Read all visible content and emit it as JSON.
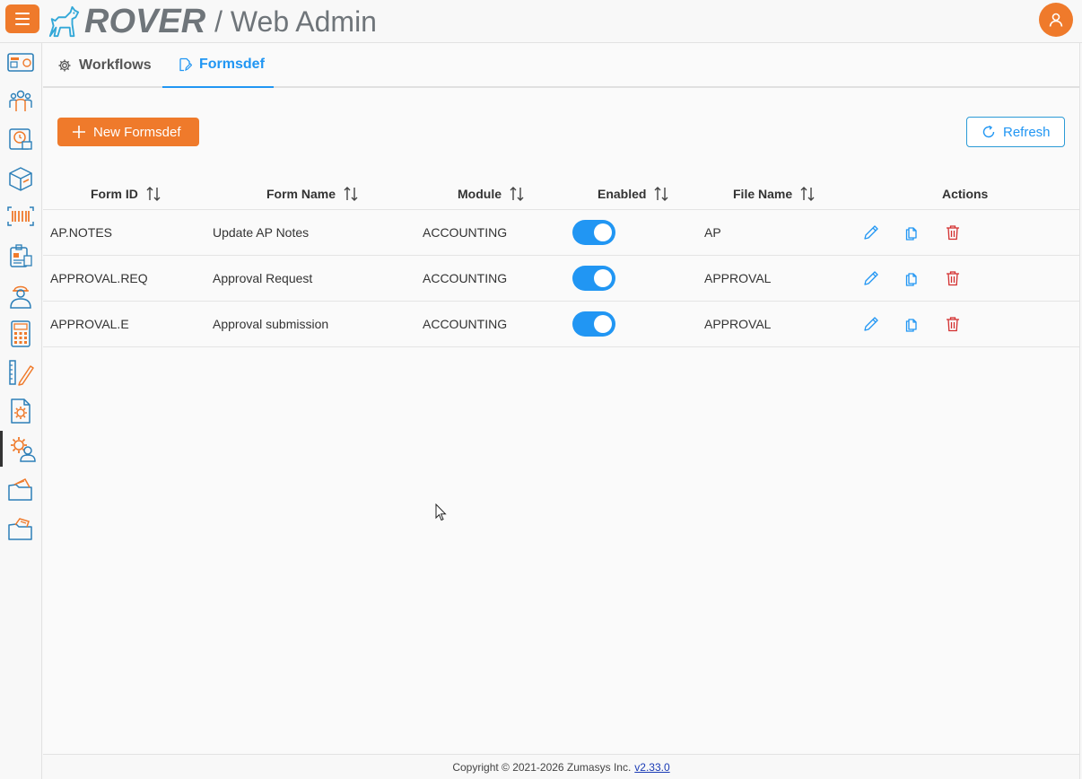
{
  "header": {
    "brand": "ROVER",
    "subtitle": "/ Web Admin",
    "menu_icon": "hamburger-icon",
    "avatar_icon": "user-icon"
  },
  "sidebar": {
    "items": [
      {
        "icon": "dashboard-icon"
      },
      {
        "icon": "users-group-icon"
      },
      {
        "icon": "clock-document-icon"
      },
      {
        "icon": "package-box-icon"
      },
      {
        "icon": "barcode-icon"
      },
      {
        "icon": "id-badge-icon"
      },
      {
        "icon": "worker-icon"
      },
      {
        "icon": "calculator-icon"
      },
      {
        "icon": "ruler-pencil-icon"
      },
      {
        "icon": "document-gear-icon"
      },
      {
        "icon": "user-gear-icon",
        "active": true
      },
      {
        "icon": "folder-open-icon"
      },
      {
        "icon": "folder-files-icon"
      }
    ]
  },
  "tabs": [
    {
      "label": "Workflows",
      "icon": "gear-icon"
    },
    {
      "label": "Formsdef",
      "icon": "edit-document-icon",
      "active": true
    }
  ],
  "toolbar": {
    "new_label": "New Formsdef",
    "refresh_label": "Refresh"
  },
  "table": {
    "columns": [
      "Form ID",
      "Form Name",
      "Module",
      "Enabled",
      "File Name",
      "Actions"
    ],
    "rows": [
      {
        "form_id": "AP.NOTES",
        "form_name": "Update AP Notes",
        "module": "ACCOUNTING",
        "enabled": true,
        "file_name": "AP"
      },
      {
        "form_id": "APPROVAL.REQ",
        "form_name": "Approval Request",
        "module": "ACCOUNTING",
        "enabled": true,
        "file_name": "APPROVAL"
      },
      {
        "form_id": "APPROVAL.E",
        "form_name": "Approval submission",
        "module": "ACCOUNTING",
        "enabled": true,
        "file_name": "APPROVAL"
      }
    ]
  },
  "footer": {
    "copyright": "Copyright © 2021-2026 Zumasys Inc.",
    "version": "v2.33.0"
  },
  "colors": {
    "accent": "#ef7a2b",
    "primary": "#2196f3",
    "danger": "#d32f2f"
  }
}
